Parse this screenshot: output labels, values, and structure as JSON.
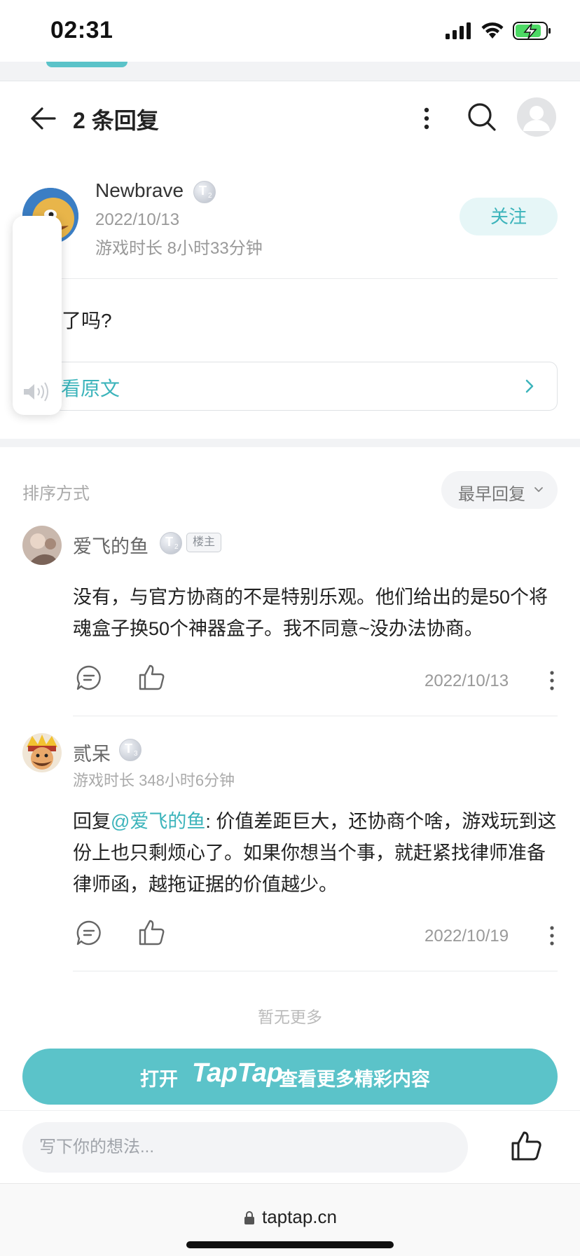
{
  "status_bar": {
    "time": "02:31"
  },
  "header": {
    "title": "2 条回复"
  },
  "post": {
    "author": "Newbrave",
    "author_level": "T",
    "author_level_sub": "2",
    "date": "2022/10/13",
    "playtime": "游戏时长 8小时33分钟",
    "follow_label": "关注",
    "body": "了吗?",
    "view_original": "看原文"
  },
  "sort": {
    "label": "排序方式",
    "selected": "最早回复"
  },
  "comments": [
    {
      "name": "爱飞的鱼",
      "level": "T",
      "level_sub": "2",
      "badge": "楼主",
      "text": "没有，与官方协商的不是特别乐观。他们给出的是50个将魂盒子换50个神器盒子。我不同意~没办法协商。",
      "date": "2022/10/13"
    },
    {
      "name": "贰呆",
      "level": "T",
      "level_sub": "3",
      "playtime": "游戏时长 348小时6分钟",
      "reply_prefix": "回复",
      "mention": "@爱飞的鱼",
      "text": ": 价值差距巨大，还协商个啥，游戏玩到这份上也只剩烦心了。如果你想当个事，就赶紧找律师准备律师函，越拖证据的价值越少。",
      "date": "2022/10/19"
    }
  ],
  "no_more": "暂无更多",
  "open_app": {
    "prefix": "打开",
    "brand": "TapTap",
    "suffix": "查看更多精彩内容"
  },
  "bottom": {
    "input_placeholder": "写下你的想法..."
  },
  "browser": {
    "url": "taptap.cn"
  },
  "colors": {
    "accent": "#5bc3c9",
    "accent_text": "#3cb4bb"
  }
}
